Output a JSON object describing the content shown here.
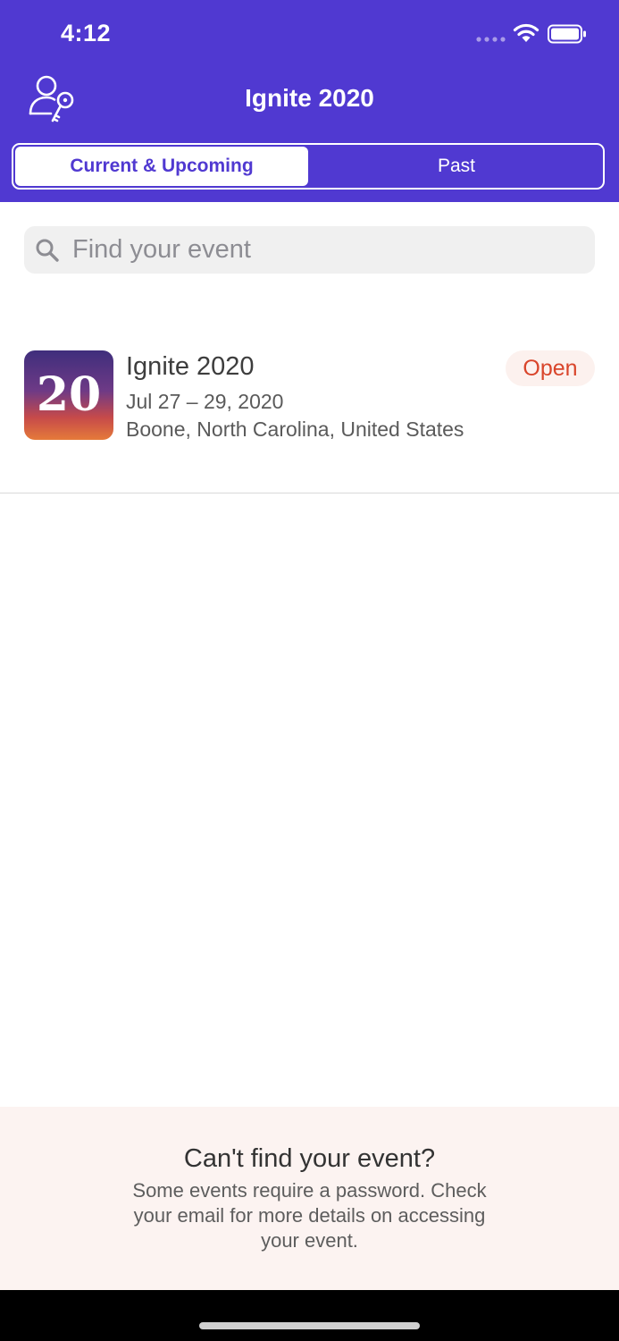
{
  "status_bar": {
    "time": "4:12",
    "icons": [
      "signal-icon",
      "wifi-icon",
      "battery-icon"
    ]
  },
  "header": {
    "title": "Ignite 2020",
    "icon": "profile-key-icon",
    "background_color": "#5039d1",
    "tabs": [
      {
        "label": "Current & Upcoming",
        "selected": true
      },
      {
        "label": "Past",
        "selected": false
      }
    ]
  },
  "search": {
    "placeholder": "Find your event",
    "value": "",
    "icon": "search-icon"
  },
  "events": [
    {
      "logo_text": "20",
      "name": "Ignite 2020",
      "dates": "Jul 27 – 29, 2020",
      "location": "Boone, North Carolina, United States",
      "status": "Open",
      "status_color": "#d9452b"
    }
  ],
  "help": {
    "title": "Can't find your event?",
    "body": "Some events require a password. Check your email for more details on accessing your event."
  }
}
